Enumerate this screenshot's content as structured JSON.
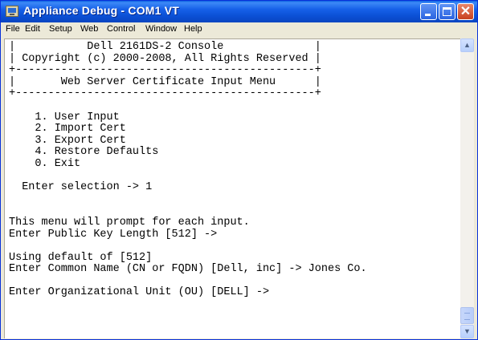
{
  "window": {
    "title": "Appliance Debug - COM1 VT"
  },
  "menubar": {
    "items": [
      "File",
      "Edit",
      "Setup",
      "Web",
      "Control",
      "Window",
      "Help"
    ]
  },
  "terminal": {
    "lines": [
      "|           Dell 2161DS-2 Console              |",
      "| Copyright (c) 2000-2008, All Rights Reserved |",
      "+----------------------------------------------+",
      "|       Web Server Certificate Input Menu      |",
      "+----------------------------------------------+",
      "",
      "    1. User Input",
      "    2. Import Cert",
      "    3. Export Cert",
      "    4. Restore Defaults",
      "    0. Exit",
      "",
      "  Enter selection -> 1",
      "",
      "",
      "This menu will prompt for each input.",
      "Enter Public Key Length [512] ->",
      "",
      "Using default of [512]",
      "Enter Common Name (CN or FQDN) [Dell, inc] -> Jones Co.",
      "",
      "Enter Organizational Unit (OU) [DELL] ->"
    ]
  },
  "icons": {
    "app": "terminal-app-icon",
    "minimize": "minimize-icon",
    "maximize": "maximize-icon",
    "close": "close-icon",
    "scroll_up": "scroll-up-arrow-icon",
    "scroll_down": "scroll-down-arrow-icon"
  },
  "colors": {
    "titlebar": "#0b50d5",
    "close_button": "#c8401e",
    "terminal_bg": "#ffffff",
    "menubar_bg": "#ece9d8"
  }
}
